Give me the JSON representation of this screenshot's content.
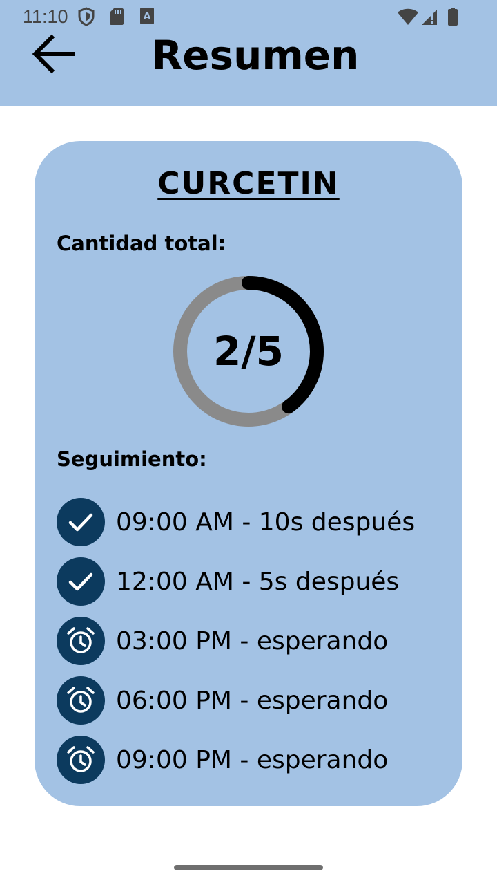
{
  "status_bar": {
    "time": "11:10",
    "left_icons": [
      "shield-icon",
      "sd-card-icon",
      "font-a-icon"
    ],
    "right_icons": [
      "wifi-icon",
      "signal-icon",
      "battery-icon"
    ]
  },
  "header": {
    "back_icon": "arrow-left-icon",
    "title": "Resumen",
    "background": "#a3c2e4"
  },
  "card": {
    "medication_name": "CURCETIN",
    "total_label": "Cantidad total:",
    "progress": {
      "taken": 2,
      "total": 5,
      "text": "2/5",
      "fraction": 0.4,
      "track_color": "#8a8a8a",
      "fill_color": "#000000"
    },
    "tracking_label": "Seguimiento:",
    "tracking": [
      {
        "text": "09:00 AM - 10s después",
        "status": "done",
        "icon": "check-icon"
      },
      {
        "text": "12:00 AM - 5s después",
        "status": "done",
        "icon": "check-icon"
      },
      {
        "text": "03:00 PM - esperando",
        "status": "pending",
        "icon": "alarm-clock-icon"
      },
      {
        "text": "06:00 PM - esperando",
        "status": "pending",
        "icon": "alarm-clock-icon"
      },
      {
        "text": "09:00 PM - esperando",
        "status": "pending",
        "icon": "alarm-clock-icon"
      }
    ],
    "icon_circle_color": "#0c3a5e",
    "background": "#a3c2e4"
  }
}
